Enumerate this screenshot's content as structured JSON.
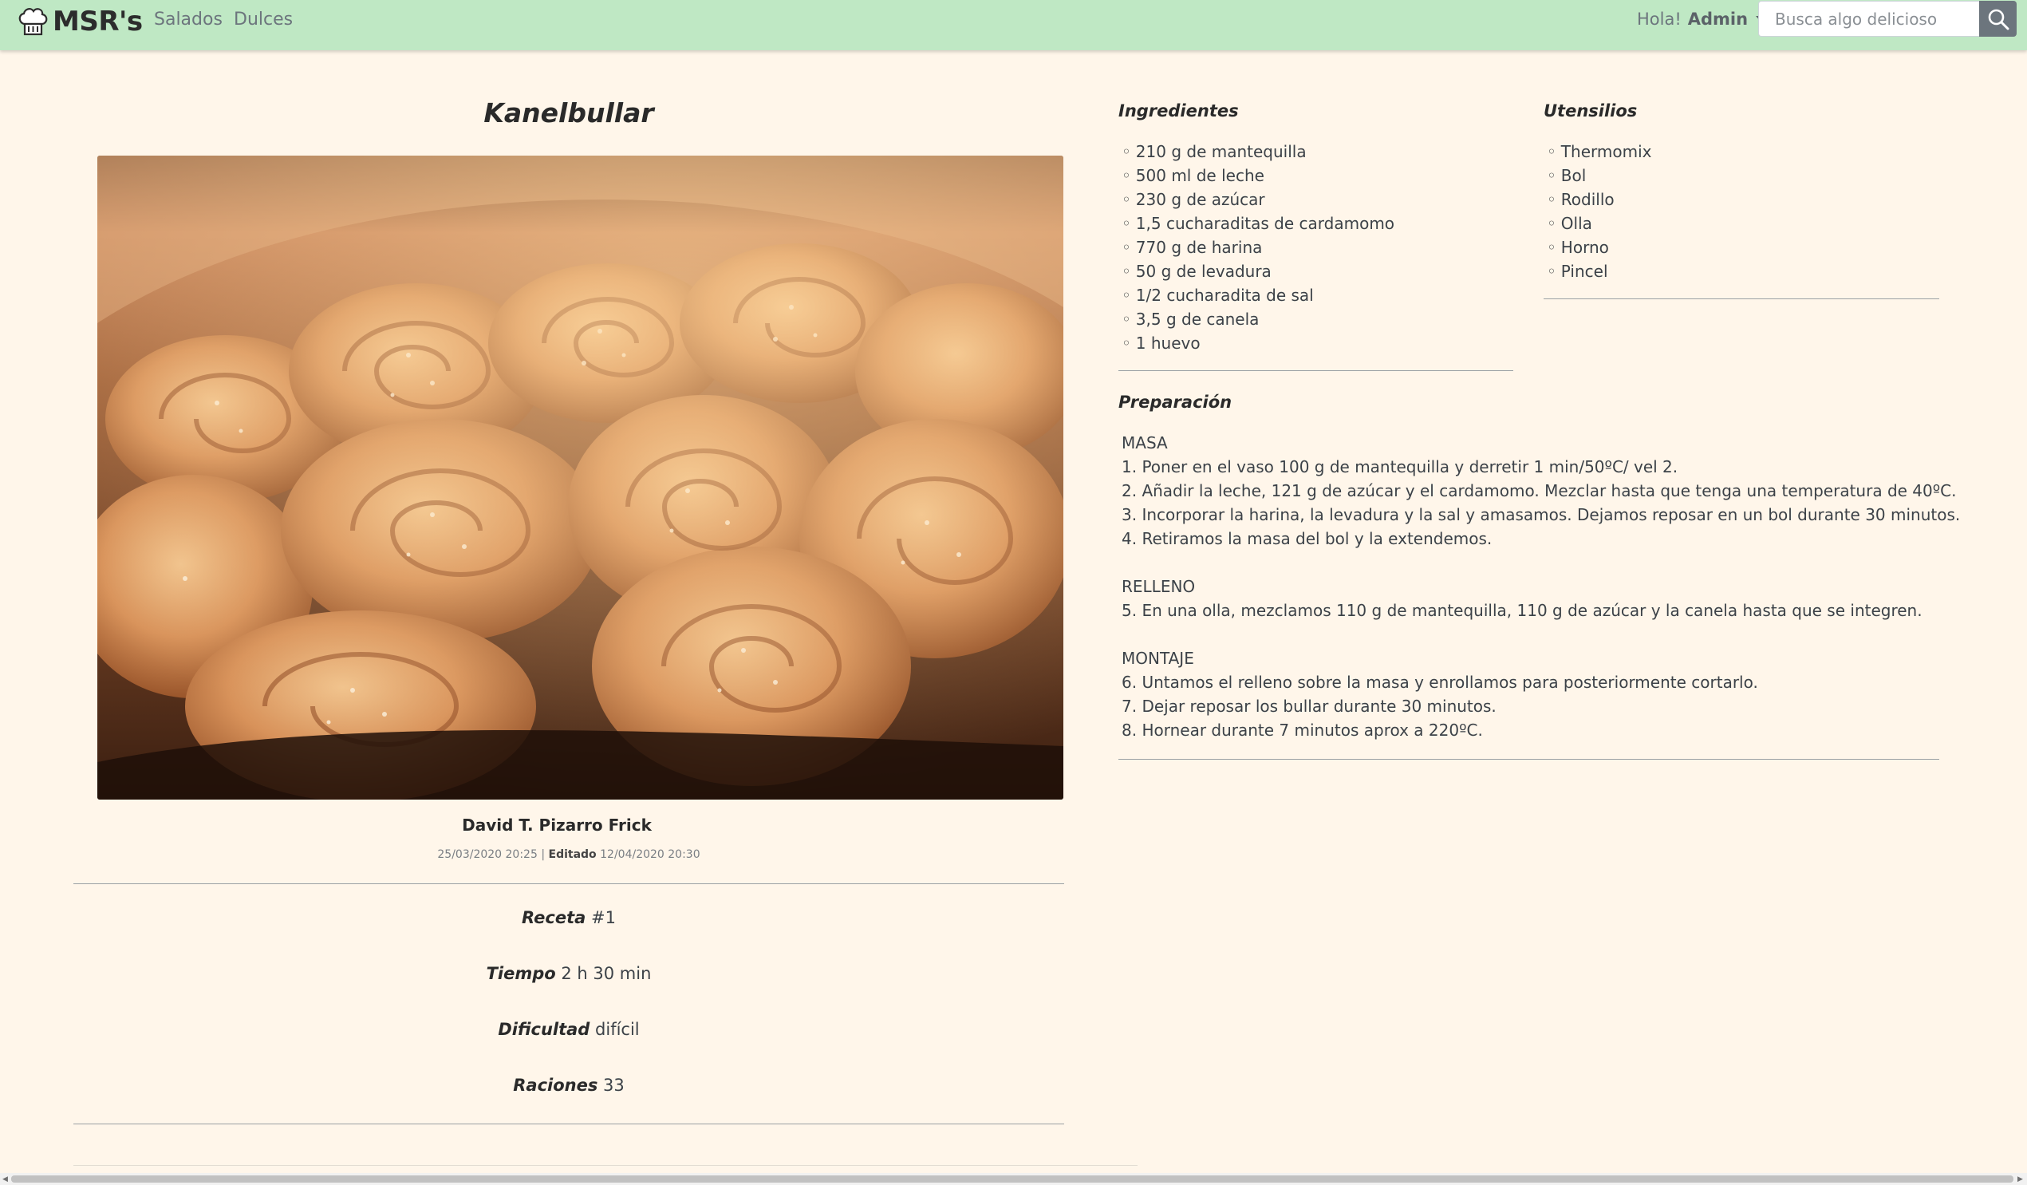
{
  "navbar": {
    "brand": "MSR's",
    "links": [
      "Salados",
      "Dulces"
    ],
    "greeting": "Hola!",
    "user": "Admin",
    "search_placeholder": "Busca algo delicioso"
  },
  "recipe": {
    "title": "Kanelbullar",
    "author": "David T. Pizarro Frick",
    "created": "25/03/2020 20:25",
    "separator": "|",
    "edited_label": "Editado",
    "edited": "12/04/2020 20:30",
    "meta": [
      {
        "label": "Receta",
        "value": "#1"
      },
      {
        "label": "Tiempo",
        "value": "2 h 30 min"
      },
      {
        "label": "Dificultad",
        "value": "difícil"
      },
      {
        "label": "Raciones",
        "value": "33"
      }
    ]
  },
  "ingredients": {
    "title": "Ingredientes",
    "items": [
      "210 g de mantequilla",
      "500 ml de leche",
      "230 g de azúcar",
      "1,5 cucharaditas de cardamomo",
      "770 g de harina",
      "50 g de levadura",
      "1/2 cucharadita de sal",
      "3,5 g de canela",
      "1 huevo"
    ]
  },
  "utensils": {
    "title": "Utensilios",
    "items": [
      "Thermomix",
      "Bol",
      "Rodillo",
      "Olla",
      "Horno",
      "Pincel"
    ]
  },
  "preparation": {
    "title": "Preparación",
    "sections": [
      {
        "heading": "MASA",
        "steps": [
          "1. Poner en el vaso 100 g de mantequilla y derretir 1 min/50ºC/ vel 2.",
          "2. Añadir la leche, 121 g de azúcar y el cardamomo. Mezclar hasta que tenga una temperatura de 40ºC.",
          "3. Incorporar la harina, la levadura y la sal y amasamos. Dejamos reposar en un bol durante 30 minutos.",
          "4. Retiramos la masa del bol y la extendemos."
        ]
      },
      {
        "heading": "RELLENO",
        "steps": [
          "5. En una olla, mezclamos 110 g de mantequilla, 110 g de azúcar y la canela hasta que se integren."
        ]
      },
      {
        "heading": "MONTAJE",
        "steps": [
          "6. Untamos el relleno sobre la masa y enrollamos para posteriormente cortarlo.",
          "7. Dejar reposar los bullar durante 30 minutos.",
          "8. Hornear durante 7 minutos aprox a 220ºC."
        ]
      }
    ]
  },
  "colors": {
    "navbar": "#bfe8c4",
    "background": "#fff6ea",
    "search_button": "#6c757d"
  },
  "icons": {
    "brand": "chef-hat-icon",
    "search": "search-icon",
    "dropdown": "caret-down-icon"
  }
}
